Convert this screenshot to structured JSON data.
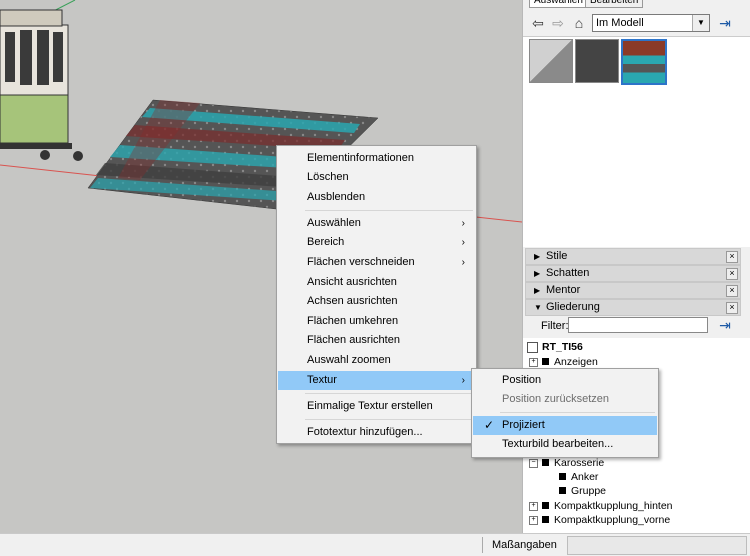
{
  "panel": {
    "tabs": [
      "Auswählen",
      "Bearbeiten"
    ],
    "location_select": "Im Modell",
    "trays": [
      {
        "label": "Stile",
        "expanded": false
      },
      {
        "label": "Schatten",
        "expanded": false
      },
      {
        "label": "Mentor",
        "expanded": false
      },
      {
        "label": "Gliederung",
        "expanded": true
      }
    ],
    "filter_label": "Filter:",
    "outliner": {
      "root": "RT_TI56",
      "items": [
        {
          "label": "Anzeigen",
          "level": 1,
          "toggle": "+"
        },
        {
          "label": "Karosserie",
          "level": 1,
          "toggle": "−"
        },
        {
          "label": "Anker",
          "level": 2,
          "toggle": ""
        },
        {
          "label": "Gruppe",
          "level": 2,
          "toggle": ""
        },
        {
          "label": "Kompaktkupplung_hinten",
          "level": 1,
          "toggle": "+"
        },
        {
          "label": "Kompaktkupplung_vorne",
          "level": 1,
          "toggle": "+"
        }
      ]
    }
  },
  "statusbar": {
    "measure_label": "Maßangaben"
  },
  "context_menu": {
    "items": [
      {
        "label": "Elementinformationen"
      },
      {
        "label": "Löschen"
      },
      {
        "label": "Ausblenden"
      },
      {
        "label": "Auswählen",
        "submenu": true
      },
      {
        "label": "Bereich",
        "submenu": true
      },
      {
        "label": "Flächen verschneiden",
        "submenu": true
      },
      {
        "label": "Ansicht ausrichten"
      },
      {
        "label": "Achsen ausrichten"
      },
      {
        "label": "Flächen umkehren"
      },
      {
        "label": "Flächen ausrichten"
      },
      {
        "label": "Auswahl zoomen"
      },
      {
        "label": "Textur",
        "submenu": true,
        "highlighted": true
      },
      {
        "label": "Einmalige Textur erstellen"
      },
      {
        "label": "Fototextur hinzufügen..."
      }
    ]
  },
  "texture_submenu": {
    "items": [
      {
        "label": "Position"
      },
      {
        "label": "Position zurücksetzen",
        "disabled": true
      },
      {
        "label": "Projiziert",
        "checked": true,
        "highlighted": true
      },
      {
        "label": "Texturbild bearbeiten..."
      }
    ]
  },
  "colors": {
    "highlight": "#91c9f7",
    "viewport_bg": "#c6c6c4",
    "axis_red": "#d9534f",
    "axis_green": "#3aa05a"
  }
}
